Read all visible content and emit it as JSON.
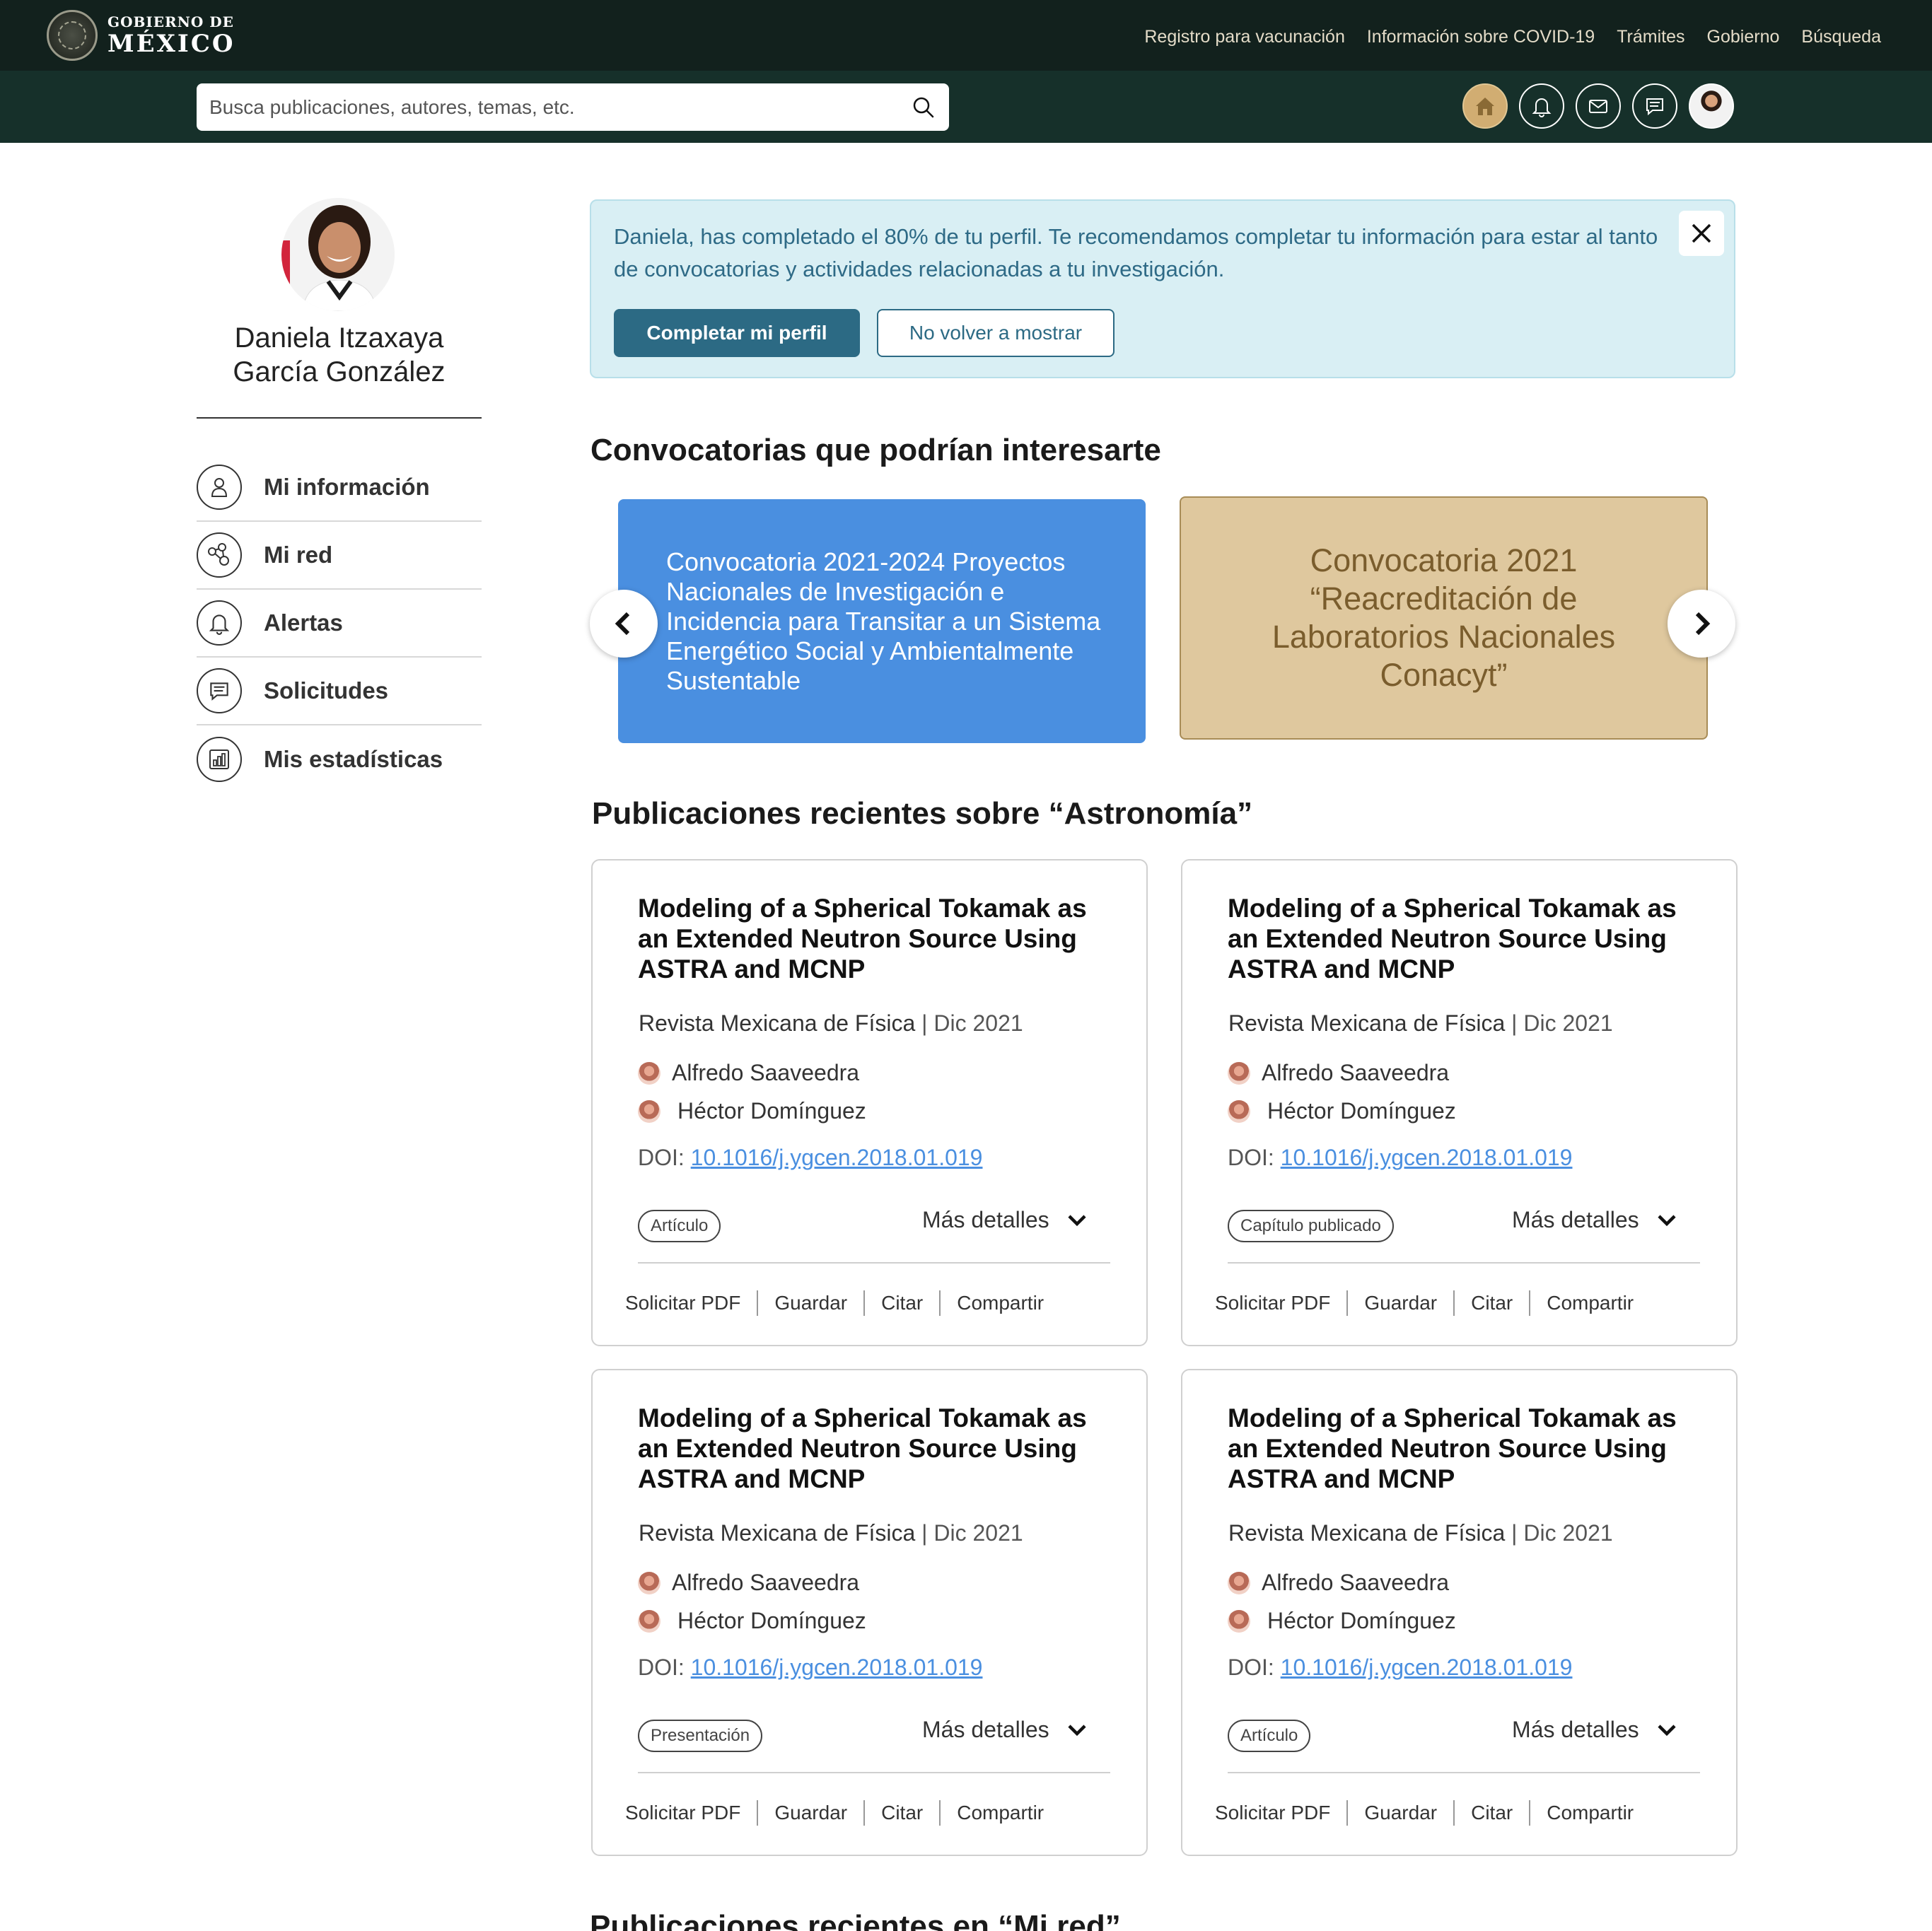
{
  "gov_bar": {
    "logo_line1": "GOBIERNO DE",
    "logo_line2": "MÉXICO",
    "nav": [
      "Registro para vacunación",
      "Información sobre COVID-19",
      "Trámites",
      "Gobierno",
      "Búsqueda"
    ]
  },
  "search": {
    "placeholder": "Busca publicaciones, autores, temas, etc.",
    "icon": "search-icon"
  },
  "header_icons": [
    "home-icon",
    "bell-icon",
    "mail-icon",
    "chat-icon",
    "user-avatar"
  ],
  "colors": {
    "gov_bar": "#12211d",
    "sub_bar": "#16302a",
    "home_accent": "#d1ad72",
    "alert_bg": "#d9eff4",
    "primary": "#2c6a84",
    "conv_blue": "#4a8fe0",
    "conv_gold": "#dfc89e",
    "link": "#4a8fe0"
  },
  "profile": {
    "name_line1": "Daniela Itzaxaya",
    "name_line2": "García González"
  },
  "menu": [
    {
      "label": "Mi información",
      "icon": "user-icon"
    },
    {
      "label": "Mi red",
      "icon": "network-icon"
    },
    {
      "label": "Alertas",
      "icon": "bell-icon"
    },
    {
      "label": "Solicitudes",
      "icon": "chat-icon"
    },
    {
      "label": "Mis estadísticas",
      "icon": "stats-icon"
    }
  ],
  "alert": {
    "text": "Daniela, has completado el 80% de tu perfil. Te recomendamos completar tu información para estar al tanto de convocatorias y actividades relacionadas a tu investigación.",
    "primary_button": "Completar mi perfil",
    "secondary_button": "No volver a mostrar"
  },
  "convocatorias": {
    "heading": "Convocatorias que podrían interesarte",
    "cards": [
      "Convocatoria 2021-2024 Proyectos Nacionales de Investigación e Incidencia para Transitar a un Sistema Energético Social y Ambientalmente Sustentable",
      "Convocatoria 2021 “Reacreditación de Laboratorios Nacionales Conacyt”"
    ]
  },
  "publicaciones": {
    "heading": "Publicaciones recientes sobre “Astronomía”",
    "cards": [
      {
        "title": "Modeling of a Spherical Tokamak as an Extended Neutron Source Using ASTRA and MCNP",
        "journal": "Revista Mexicana de Física",
        "date": "| Dic 2021",
        "authors": [
          "Alfredo Saaveedra",
          "Héctor Domínguez"
        ],
        "doi_label": "DOI:",
        "doi": "10.1016/j.ygcen.2018.01.019",
        "tag": "Artículo",
        "more": "Más detalles"
      },
      {
        "title": "Modeling of a Spherical Tokamak as an Extended Neutron Source Using ASTRA and MCNP",
        "journal": "Revista Mexicana de Física",
        "date": "| Dic 2021",
        "authors": [
          "Alfredo Saaveedra",
          "Héctor Domínguez"
        ],
        "doi_label": "DOI:",
        "doi": "10.1016/j.ygcen.2018.01.019",
        "tag": "Capítulo publicado",
        "more": "Más detalles"
      },
      {
        "title": "Modeling of a Spherical Tokamak as an Extended Neutron Source Using ASTRA and MCNP",
        "journal": "Revista Mexicana de Física",
        "date": "| Dic 2021",
        "authors": [
          "Alfredo Saaveedra",
          "Héctor Domínguez"
        ],
        "doi_label": "DOI:",
        "doi": "10.1016/j.ygcen.2018.01.019",
        "tag": "Presentación",
        "more": "Más detalles"
      },
      {
        "title": "Modeling of a Spherical Tokamak as an Extended Neutron Source Using ASTRA and MCNP",
        "journal": "Revista Mexicana de Física",
        "date": "| Dic 2021",
        "authors": [
          "Alfredo Saaveedra",
          "Héctor Domínguez"
        ],
        "doi_label": "DOI:",
        "doi": "10.1016/j.ygcen.2018.01.019",
        "tag": "Artículo",
        "more": "Más detalles"
      }
    ],
    "actions": [
      "Solicitar PDF",
      "Guardar",
      "Citar",
      "Compartir"
    ]
  },
  "next_section_heading": "Publicaciones recientes en “Mi red”"
}
